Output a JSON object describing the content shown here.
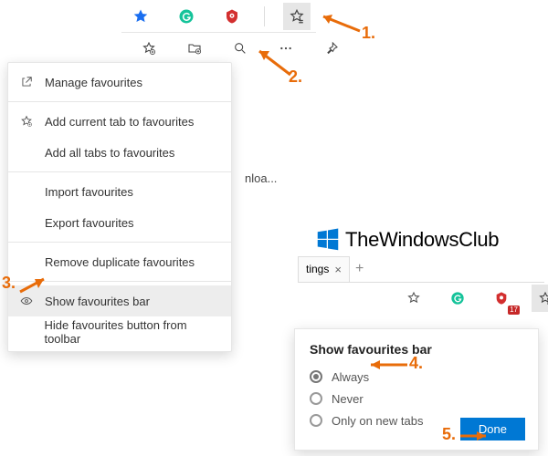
{
  "toolbar": {
    "fav_lines_active": true
  },
  "menu": {
    "manage": "Manage favourites",
    "add_current": "Add current tab to favourites",
    "add_all": "Add all tabs to favourites",
    "import": "Import favourites",
    "export": "Export favourites",
    "remove_dupes": "Remove duplicate favourites",
    "show_bar": "Show favourites bar",
    "hide_button": "Hide favourites button from toolbar"
  },
  "truncated_text": "nloa...",
  "watermark": {
    "text": "TheWindowsClub"
  },
  "tab": {
    "label": "tings",
    "close": "×",
    "add": "+"
  },
  "right_toolbar": {
    "badge_count": "17"
  },
  "dialog": {
    "title": "Show favourites bar",
    "options": [
      "Always",
      "Never",
      "Only on new tabs"
    ],
    "selected": 0,
    "done": "Done"
  },
  "annotations": {
    "n1": "1.",
    "n2": "2.",
    "n3": "3.",
    "n4": "4.",
    "n5": "5."
  },
  "colors": {
    "accent": "#0078d4",
    "annotation": "#e86c0a",
    "star_blue": "#1a6ef0",
    "grammarly": "#15c39a",
    "ublock": "#d32f2f"
  }
}
